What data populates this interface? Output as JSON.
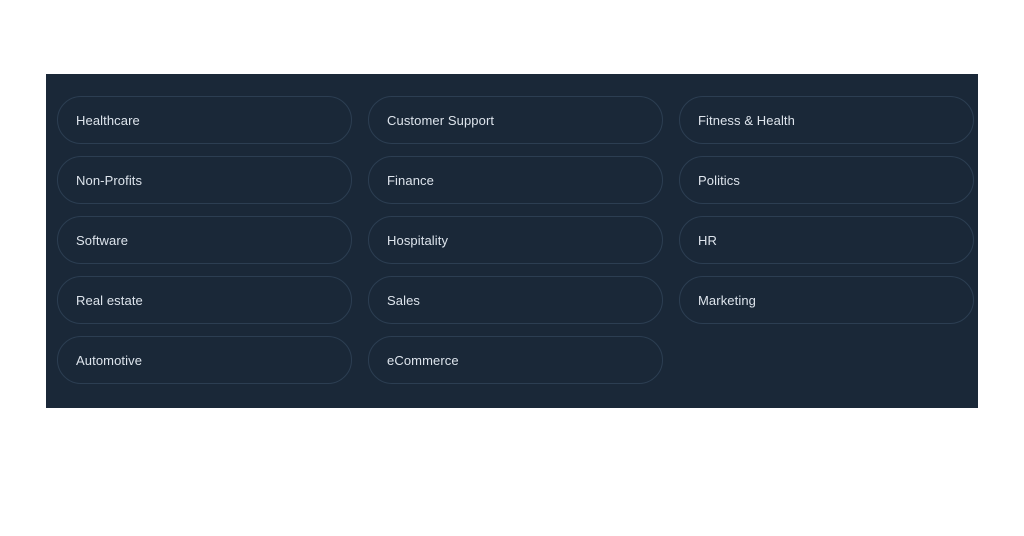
{
  "page": {
    "background_color": "#ffffff"
  },
  "panel": {
    "background_color": "#1a2838",
    "border_color": "#2c3e52",
    "text_color": "#dde4ec"
  },
  "categories": {
    "columns": [
      {
        "items": [
          {
            "label": "Healthcare"
          },
          {
            "label": "Non-Profits"
          },
          {
            "label": "Software"
          },
          {
            "label": "Real estate"
          },
          {
            "label": "Automotive"
          }
        ]
      },
      {
        "items": [
          {
            "label": "Customer Support"
          },
          {
            "label": "Finance"
          },
          {
            "label": "Hospitality"
          },
          {
            "label": "Sales"
          },
          {
            "label": "eCommerce"
          }
        ]
      },
      {
        "items": [
          {
            "label": "Fitness & Health"
          },
          {
            "label": "Politics"
          },
          {
            "label": "HR"
          },
          {
            "label": "Marketing"
          }
        ]
      }
    ]
  }
}
